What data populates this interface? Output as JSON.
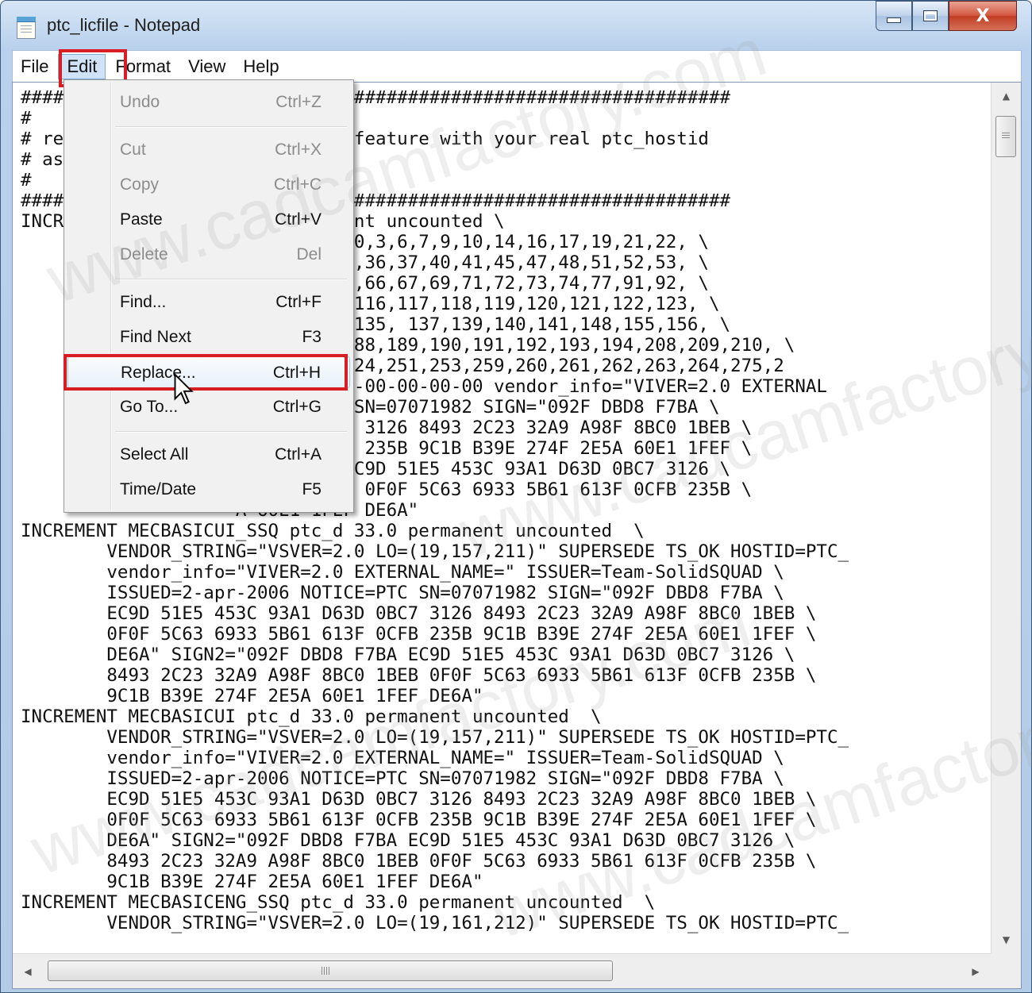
{
  "window": {
    "title": "ptc_licfile - Notepad",
    "caption_buttons": {
      "minimize": "minimize",
      "maximize": "maximize",
      "close": "X"
    }
  },
  "menubar": {
    "items": [
      "File",
      "Edit",
      "Format",
      "View",
      "Help"
    ],
    "active": "Edit"
  },
  "edit_menu": {
    "items": [
      {
        "label": "Undo",
        "shortcut": "Ctrl+Z",
        "enabled": false
      },
      {
        "label": "Cut",
        "shortcut": "Ctrl+X",
        "enabled": false
      },
      {
        "label": "Copy",
        "shortcut": "Ctrl+C",
        "enabled": false
      },
      {
        "label": "Paste",
        "shortcut": "Ctrl+V",
        "enabled": true
      },
      {
        "label": "Delete",
        "shortcut": "Del",
        "enabled": false
      },
      {
        "label": "Find...",
        "shortcut": "Ctrl+F",
        "enabled": true
      },
      {
        "label": "Find Next",
        "shortcut": "F3",
        "enabled": true
      },
      {
        "label": "Replace...",
        "shortcut": "Ctrl+H",
        "enabled": true,
        "hovered": true
      },
      {
        "label": "Go To...",
        "shortcut": "Ctrl+G",
        "enabled": true
      },
      {
        "label": "Select All",
        "shortcut": "Ctrl+A",
        "enabled": true
      },
      {
        "label": "Time/Date",
        "shortcut": "F5",
        "enabled": true
      }
    ]
  },
  "document": {
    "lines": [
      "####                ##############################################",
      "#",
      "# re                0 in every-feature with your real ptc_hostid",
      "# as",
      "#",
      "####                ##############################################",
      "INCR                3.0 permanent uncounted \\",
      "                    ER=2.0 LO=(0,3,6,7,9,10,14,16,17,19,21,22, \\",
      "                    31,32,34,35,36,37,40,41,45,47,48,51,52,53, \\",
      "                    61,62,63,65,66,67,69,71,72,73,74,77,91,92, \\",
      "                    06,108,115,116,117,118,119,120,121,122,123, \\",
      "                    31,133,134,135, 137,139,140,141,148,155,156, \\",
      "                    7,168,187,188,189,190,191,192,193,194,208,209,210, \\",
      "                    0,221,222,224,251,253,259,260,261,262,263,264,275,2",
      "                    OSTID=00-00-00-00-00-00 vendor_info=\"VIVER=2.0 EXTERNAL",
      "                    NOTICE=PTC SN=07071982 SIGN=\"092F DBD8 F7BA \\",
      "                    1 D63D 0BC7 3126 8493 2C23 32A9 A98F 8BC0 1BEB \\",
      "                    1 613F 0CFB 235B 9C1B B39E 274F 2E5A 60E1 1FEF \\",
      "                    DBD8 F7BA EC9D 51E5 453C 93A1 D63D 0BC7 3126 \\",
      "                    F 8BC0 1BEB 0F0F 5C63 6933 5B61 613F 0CFB 235B \\",
      "                    A 60E1 1FEF DE6A\"",
      "INCREMENT MECBASICUI_SSQ ptc_d 33.0 permanent uncounted  \\",
      "        VENDOR_STRING=\"VSVER=2.0 LO=(19,157,211)\" SUPERSEDE TS_OK HOSTID=PTC_",
      "        vendor_info=\"VIVER=2.0 EXTERNAL_NAME=\" ISSUER=Team-SolidSQUAD \\",
      "        ISSUED=2-apr-2006 NOTICE=PTC SN=07071982 SIGN=\"092F DBD8 F7BA \\",
      "        EC9D 51E5 453C 93A1 D63D 0BC7 3126 8493 2C23 32A9 A98F 8BC0 1BEB \\",
      "        0F0F 5C63 6933 5B61 613F 0CFB 235B 9C1B B39E 274F 2E5A 60E1 1FEF \\",
      "        DE6A\" SIGN2=\"092F DBD8 F7BA EC9D 51E5 453C 93A1 D63D 0BC7 3126 \\",
      "        8493 2C23 32A9 A98F 8BC0 1BEB 0F0F 5C63 6933 5B61 613F 0CFB 235B \\",
      "        9C1B B39E 274F 2E5A 60E1 1FEF DE6A\"",
      "INCREMENT MECBASICUI ptc_d 33.0 permanent uncounted  \\",
      "        VENDOR_STRING=\"VSVER=2.0 LO=(19,157,211)\" SUPERSEDE TS_OK HOSTID=PTC_",
      "        vendor_info=\"VIVER=2.0 EXTERNAL_NAME=\" ISSUER=Team-SolidSQUAD \\",
      "        ISSUED=2-apr-2006 NOTICE=PTC SN=07071982 SIGN=\"092F DBD8 F7BA \\",
      "        EC9D 51E5 453C 93A1 D63D 0BC7 3126 8493 2C23 32A9 A98F 8BC0 1BEB \\",
      "        0F0F 5C63 6933 5B61 613F 0CFB 235B 9C1B B39E 274F 2E5A 60E1 1FEF \\",
      "        DE6A\" SIGN2=\"092F DBD8 F7BA EC9D 51E5 453C 93A1 D63D 0BC7 3126 \\",
      "        8493 2C23 32A9 A98F 8BC0 1BEB 0F0F 5C63 6933 5B61 613F 0CFB 235B \\",
      "        9C1B B39E 274F 2E5A 60E1 1FEF DE6A\"",
      "INCREMENT MECBASICENG_SSQ ptc_d 33.0 permanent uncounted  \\",
      "        VENDOR_STRING=\"VSVER=2.0 LO=(19,161,212)\" SUPERSEDE TS_OK HOSTID=PTC_"
    ]
  },
  "scrollbars": {
    "h_thumb_grip": "III"
  },
  "watermark": {
    "text": "www.cadcamfactory.com"
  },
  "colors": {
    "highlight_box": "#d81e22",
    "menu_hover": "#e7f0fa",
    "title_bar": "#b9d1ec"
  }
}
